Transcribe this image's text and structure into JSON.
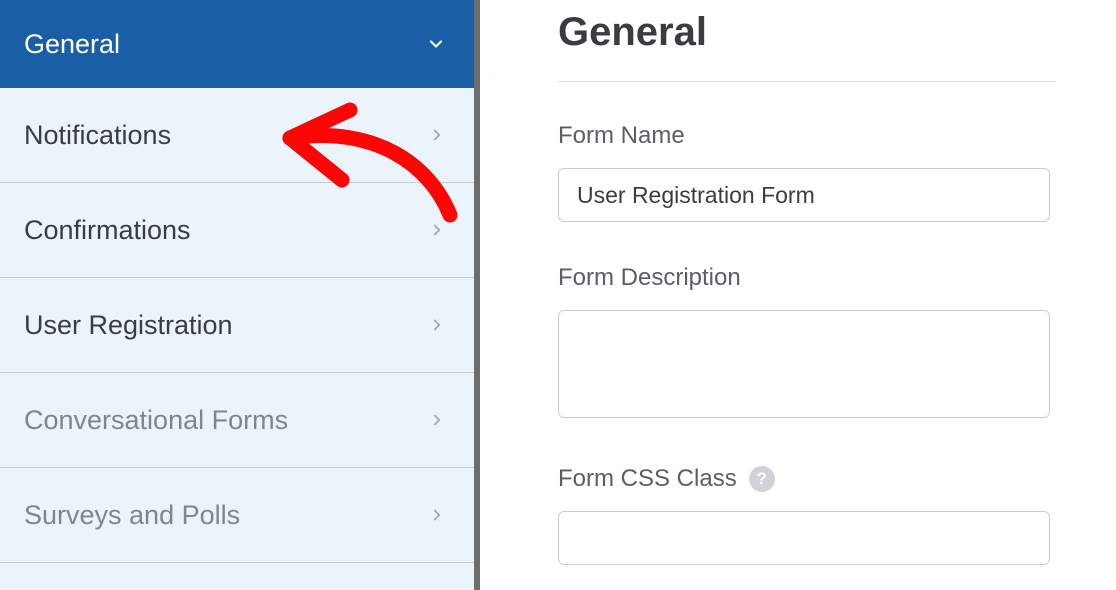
{
  "sidebar": {
    "items": [
      {
        "label": "General",
        "active": true,
        "disabled": false
      },
      {
        "label": "Notifications",
        "active": false,
        "disabled": false
      },
      {
        "label": "Confirmations",
        "active": false,
        "disabled": false
      },
      {
        "label": "User Registration",
        "active": false,
        "disabled": false
      },
      {
        "label": "Conversational Forms",
        "active": false,
        "disabled": true
      },
      {
        "label": "Surveys and Polls",
        "active": false,
        "disabled": true
      }
    ]
  },
  "main": {
    "heading": "General",
    "form_name_label": "Form Name",
    "form_name_value": "User Registration Form",
    "form_description_label": "Form Description",
    "form_description_value": "",
    "form_css_class_label": "Form CSS Class",
    "form_css_class_value": ""
  },
  "colors": {
    "accent": "#1a5ea6",
    "sidebar_bg": "#ecf4fb",
    "text_dark": "#3a3d40",
    "text_muted": "#7f858b",
    "annotation": "#fb0505"
  }
}
